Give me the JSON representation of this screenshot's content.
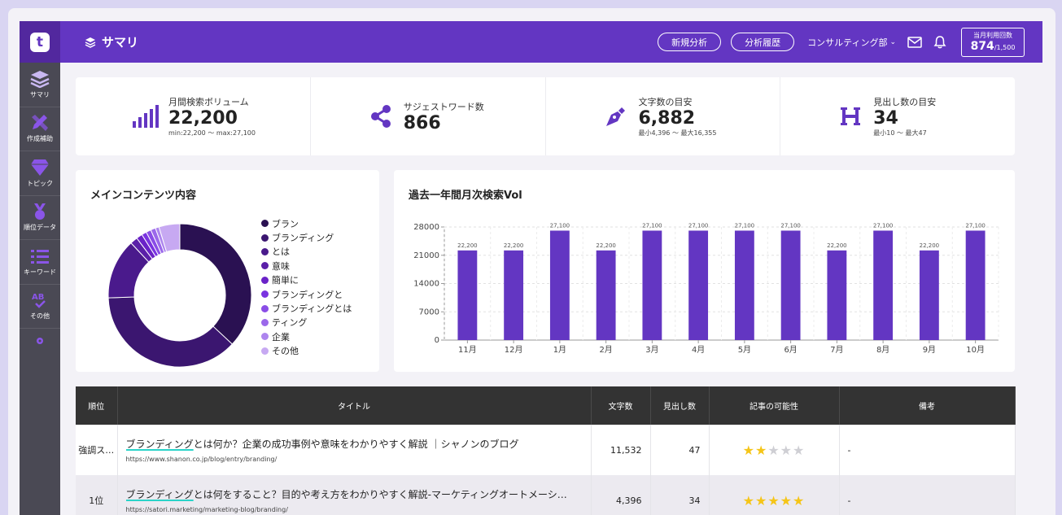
{
  "header": {
    "title": "サマリ",
    "new_analysis": "新規分析",
    "history": "分析履歴",
    "department": "コンサルティング部",
    "usage_label": "当月利用回数",
    "usage_count": "874",
    "usage_limit": "/1,500"
  },
  "sidebar": {
    "items": [
      {
        "label": "サマリ",
        "icon": "layers-icon"
      },
      {
        "label": "作成補助",
        "icon": "pencil-ruler-icon"
      },
      {
        "label": "トピック",
        "icon": "gem-icon"
      },
      {
        "label": "順位データ",
        "icon": "medal-icon"
      },
      {
        "label": "キーワード",
        "icon": "list-icon"
      },
      {
        "label": "その他",
        "icon": "ab-check-icon"
      }
    ]
  },
  "stats": [
    {
      "label": "月間検索ボリューム",
      "value": "22,200",
      "range": "min:22,200 〜 max:27,100",
      "icon": "signal-bars-icon"
    },
    {
      "label": "サジェストワード数",
      "value": "866",
      "range": "",
      "icon": "share-icon"
    },
    {
      "label": "文字数の目安",
      "value": "6,882",
      "range": "最小4,396 〜 最大16,355",
      "icon": "pen-nib-icon"
    },
    {
      "label": "見出し数の目安",
      "value": "34",
      "range": "最小10 〜 最大47",
      "icon": "heading-icon"
    }
  ],
  "colors": {
    "brand": "#6336c2",
    "bar": "#6336c2",
    "highlight": "#2ad3c9"
  },
  "donut": {
    "title": "メインコンテンツ内容",
    "legend": [
      {
        "label": "ブラン",
        "color": "#2a1152"
      },
      {
        "label": "ブランディング",
        "color": "#3b1670"
      },
      {
        "label": "とは",
        "color": "#4a1a8c"
      },
      {
        "label": "意味",
        "color": "#5a20a8"
      },
      {
        "label": "簡単に",
        "color": "#6a22c8"
      },
      {
        "label": "ブランディングと",
        "color": "#7a33e0"
      },
      {
        "label": "ブランディングとは",
        "color": "#8a4de6"
      },
      {
        "label": "ティング",
        "color": "#9b68ea"
      },
      {
        "label": "企業",
        "color": "#ad85ee"
      },
      {
        "label": "その他",
        "color": "#c7a9f2"
      }
    ]
  },
  "chart_data": {
    "type": "bar",
    "title": "過去一年間月次検索Vol",
    "categories": [
      "11月",
      "12月",
      "1月",
      "2月",
      "3月",
      "4月",
      "5月",
      "6月",
      "7月",
      "8月",
      "9月",
      "10月"
    ],
    "values": [
      22200,
      22200,
      27100,
      22200,
      27100,
      27100,
      27100,
      27100,
      22200,
      27100,
      22200,
      27100
    ],
    "value_labels": [
      "22,200",
      "22,200",
      "27,100",
      "22,200",
      "27,100",
      "27,100",
      "27,100",
      "27,100",
      "22,200",
      "27,100",
      "22,200",
      "27,100"
    ],
    "ylim": [
      0,
      28000
    ],
    "yticks": [
      0,
      7000,
      14000,
      21000,
      28000
    ],
    "grid": true
  },
  "table": {
    "headers": [
      "順位",
      "タイトル",
      "文字数",
      "見出し数",
      "記事の可能性",
      "備考"
    ],
    "rows": [
      {
        "rank": "強調ス…",
        "keyword": "ブランディング",
        "title_rest": "とは何か？企業の成功事例や意味をわかりやすく解説 ｜シャノンのブログ",
        "url": "https://www.shanon.co.jp/blog/entry/branding/",
        "chars": "11,532",
        "headings": "47",
        "stars": 2,
        "note": "-"
      },
      {
        "rank": "1位",
        "keyword": "ブランディング",
        "title_rest": "とは何をすること？目的や考え方をわかりやすく解説-マーケティングオートメーシ…",
        "url": "https://satori.marketing/marketing-blog/branding/",
        "chars": "4,396",
        "headings": "34",
        "stars": 5,
        "note": "-"
      }
    ]
  }
}
